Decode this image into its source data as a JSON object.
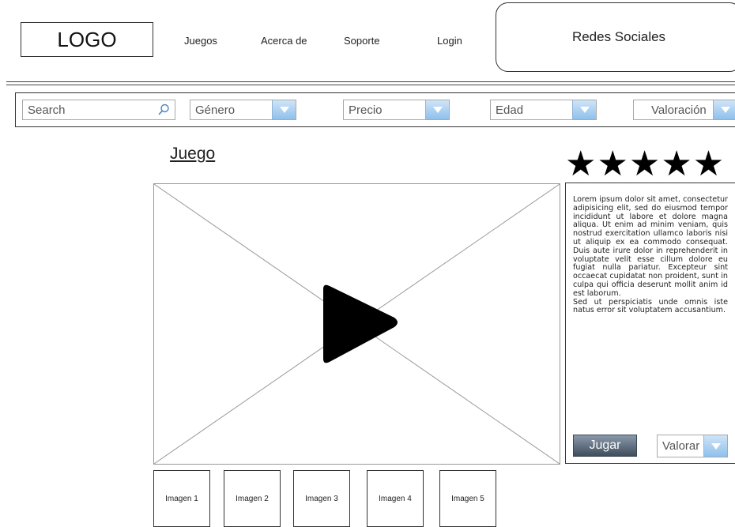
{
  "header": {
    "logo": "LOGO",
    "nav": [
      "Juegos",
      "Acerca de",
      "Soporte",
      "Login"
    ],
    "social": "Redes Sociales"
  },
  "filters": {
    "search_placeholder": "Search",
    "dropdowns": [
      "Género",
      "Precio",
      "Edad",
      "Valoración"
    ]
  },
  "game": {
    "title": "Juego",
    "rating_stars": 5,
    "stars_text": "★★★★★",
    "description": "Lorem ipsum dolor sit amet, consectetur adipisicing elit, sed do eiusmod tempor incididunt ut labore et dolore magna aliqua. Ut enim ad minim veniam, quis nostrud exercitation ullamco laboris nisi ut aliquip ex ea commodo consequat. Duis aute irure dolor in reprehenderit in voluptate velit esse cillum dolore eu fugiat nulla pariatur. Excepteur sint occaecat cupidatat non proident, sunt in culpa qui officia deserunt mollit anim id est laborum.\nSed ut perspiciatis unde omnis iste natus error sit voluptatem accusantium.",
    "play_label": "Jugar",
    "rate_label": "Valorar"
  },
  "thumbnails": [
    "Imagen 1",
    "Imagen 2",
    "Imagen 3",
    "Imagen 4",
    "Imagen 5"
  ],
  "colors": {
    "dropdown_accent": "#8fc0ec",
    "play_button": "#4e5d6c"
  }
}
